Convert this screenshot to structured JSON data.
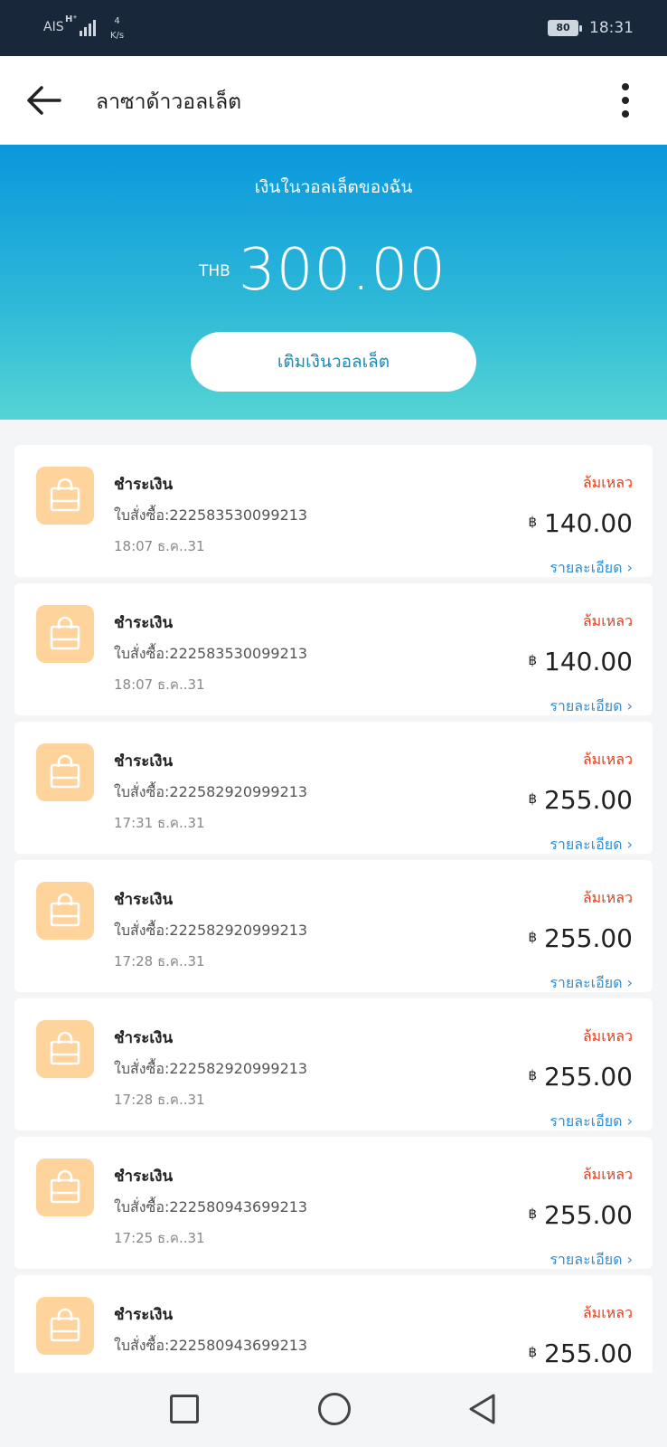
{
  "status_bar": {
    "carrier": "AIS",
    "network": "H⁺",
    "speed_value": "4",
    "speed_unit": "K/s",
    "battery": "80",
    "time": "18:31"
  },
  "app_bar": {
    "title": "ลาซาด้าวอลเล็ต"
  },
  "wallet": {
    "label": "เงินในวอลเล็ตของฉัน",
    "currency": "THB",
    "balance": "300.00",
    "topup_label": "เติมเงินวอลเล็ต"
  },
  "transactions": [
    {
      "type": "ชำระเงิน",
      "order": "ใบสั่งซื้อ:222583530099213",
      "time": "18:07 ธ.ค..31",
      "status": "ล้มเหลว",
      "currency_symbol": "฿",
      "amount": "140.00",
      "detail": "รายละเอียด ›"
    },
    {
      "type": "ชำระเงิน",
      "order": "ใบสั่งซื้อ:222583530099213",
      "time": "18:07 ธ.ค..31",
      "status": "ล้มเหลว",
      "currency_symbol": "฿",
      "amount": "140.00",
      "detail": "รายละเอียด ›"
    },
    {
      "type": "ชำระเงิน",
      "order": "ใบสั่งซื้อ:222582920999213",
      "time": "17:31 ธ.ค..31",
      "status": "ล้มเหลว",
      "currency_symbol": "฿",
      "amount": "255.00",
      "detail": "รายละเอียด ›"
    },
    {
      "type": "ชำระเงิน",
      "order": "ใบสั่งซื้อ:222582920999213",
      "time": "17:28 ธ.ค..31",
      "status": "ล้มเหลว",
      "currency_symbol": "฿",
      "amount": "255.00",
      "detail": "รายละเอียด ›"
    },
    {
      "type": "ชำระเงิน",
      "order": "ใบสั่งซื้อ:222582920999213",
      "time": "17:28 ธ.ค..31",
      "status": "ล้มเหลว",
      "currency_symbol": "฿",
      "amount": "255.00",
      "detail": "รายละเอียด ›"
    },
    {
      "type": "ชำระเงิน",
      "order": "ใบสั่งซื้อ:222580943699213",
      "time": "17:25 ธ.ค..31",
      "status": "ล้มเหลว",
      "currency_symbol": "฿",
      "amount": "255.00",
      "detail": "รายละเอียด ›"
    },
    {
      "type": "ชำระเงิน",
      "order": "ใบสั่งซื้อ:222580943699213",
      "time": "",
      "status": "ล้มเหลว",
      "currency_symbol": "฿",
      "amount": "255.00",
      "detail": ""
    }
  ],
  "colors": {
    "status_bar_bg": "#18283a",
    "header_gradient_top": "#0a97dd",
    "header_gradient_bottom": "#54d4d4",
    "icon_bg": "#ffd39c",
    "failed": "#e0401e",
    "link": "#2f8fd3"
  },
  "icons": {
    "back": "arrow-left-icon",
    "more": "more-vertical-icon",
    "transaction": "shopping-bag-icon",
    "nav_recent": "square-icon",
    "nav_home": "circle-icon",
    "nav_back": "triangle-back-icon"
  }
}
